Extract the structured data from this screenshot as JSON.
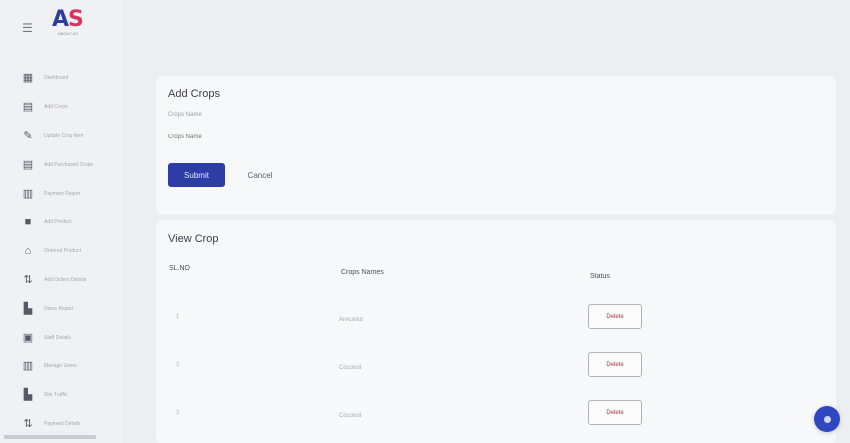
{
  "brand": {
    "logo_text": "AS",
    "logo_sub": "ABOUT AS"
  },
  "sidebar": {
    "items": [
      {
        "label": "Dashboard",
        "icon": "grid-icon"
      },
      {
        "label": "Add Crops",
        "icon": "document-icon"
      },
      {
        "label": "Update Crop Item",
        "icon": "pencil-icon"
      },
      {
        "label": "Add Purchased Crops",
        "icon": "document-icon"
      },
      {
        "label": "Payment Report",
        "icon": "table-icon"
      },
      {
        "label": "Add Product",
        "icon": "square-icon"
      },
      {
        "label": "Ordered Product",
        "icon": "tag-icon"
      },
      {
        "label": "Add Orders Details",
        "icon": "sort-icon"
      },
      {
        "label": "Users Report",
        "icon": "bar-chart-icon"
      },
      {
        "label": "Staff Details",
        "icon": "id-card-icon"
      },
      {
        "label": "Manage Users",
        "icon": "table-icon"
      },
      {
        "label": "Site Traffic",
        "icon": "bar-chart-icon"
      },
      {
        "label": "Payment Details",
        "icon": "sort-icon"
      }
    ]
  },
  "add_crops": {
    "title": "Add Crops",
    "field_label": "Crops Name",
    "placeholder": "Crops Name",
    "submit_label": "Submit",
    "cancel_label": "Cancel"
  },
  "view_crop": {
    "title": "View Crop",
    "columns": [
      "SL.NO",
      "Crops Names",
      "Status"
    ],
    "rows": [
      {
        "sl": "1",
        "name": "Arecanut",
        "action": "Delete"
      },
      {
        "sl": "2",
        "name": "Coconut",
        "action": "Delete"
      },
      {
        "sl": "3",
        "name": "Coconut",
        "action": "Delete"
      }
    ]
  },
  "colors": {
    "primary": "#2c3da6",
    "danger": "#b23a4a",
    "logo_blue": "#2f3e9e",
    "logo_pink": "#d8345f"
  }
}
